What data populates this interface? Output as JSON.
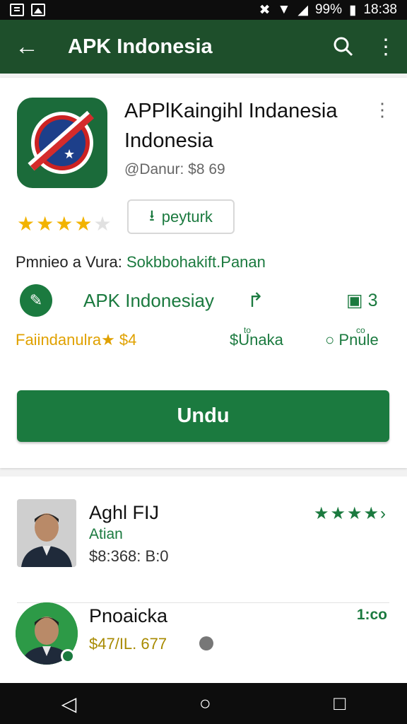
{
  "status_bar": {
    "battery": "99%",
    "time": "18:38",
    "icons": [
      "document-icon",
      "image-icon",
      "mute-icon",
      "wifi-icon",
      "signal-icon",
      "battery-icon"
    ]
  },
  "app_bar": {
    "title": "APK Indonesia",
    "back_icon": "arrow-left",
    "search_icon": "search",
    "menu_icon": "more-vertical"
  },
  "app": {
    "title": "APPlKaingihl Indanesia Indonesia",
    "price": "@Danur: $8 69",
    "rating": 3.5,
    "rating_max": 5,
    "chip_label": "peyturk",
    "premium_label": "Pmnieo a Vura:",
    "premium_link": "Sokbbohakift.Panan",
    "developer": "APK Indonesiay",
    "count": "3",
    "stat_a": "Faiindanulra★ $4",
    "stat_b": "$Unaka",
    "stat_b_tiny": "to",
    "stat_c": "Pnule",
    "stat_c_tiny": "co",
    "install_label": "Undu"
  },
  "list_items": [
    {
      "name": "Aghl FIJ",
      "sub": "Atian",
      "price": "$8:368: B:0",
      "stars": "★★★★›",
      "rating": 4
    },
    {
      "name": "Pnoaicka",
      "price": "$47/IL. 677",
      "time": "1:co"
    }
  ],
  "colors": {
    "app_bar": "#1e4f2b",
    "accent": "#1b7a3f",
    "star": "#f2b300",
    "stat_yellow": "#e0a100"
  }
}
